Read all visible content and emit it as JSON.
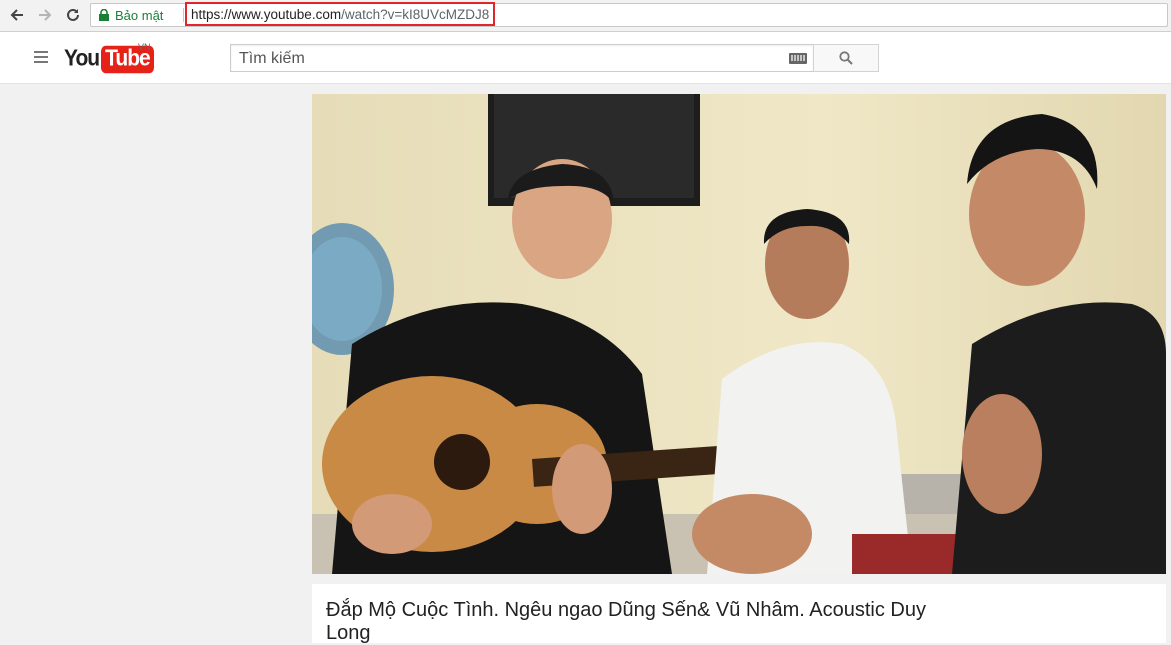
{
  "browser": {
    "secure_label": "Bảo mật",
    "url_host": "https://www.youtube.com",
    "url_path": "/watch?v=kI8UVcMZDJ8"
  },
  "header": {
    "logo_you": "You",
    "logo_tube": "Tube",
    "country": "VN",
    "search_placeholder": "Tìm kiếm"
  },
  "video": {
    "title": "Đắp Mộ Cuộc Tình. Ngêu ngao Dũng Sến& Vũ Nhâm. Acoustic Duy Long"
  },
  "colors": {
    "brand_red": "#e62117",
    "secure_green": "#1a7f37",
    "url_highlight": "#e0262a"
  }
}
